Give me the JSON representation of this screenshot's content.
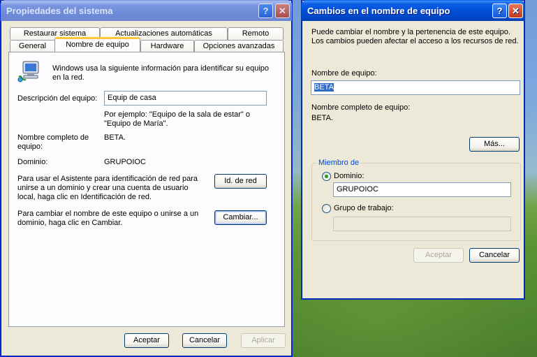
{
  "left_window": {
    "title": "Propiedades del sistema",
    "help_glyph": "?",
    "close_glyph": "✕",
    "tabs_row1": [
      "Restaurar sistema",
      "Actualizaciones automáticas",
      "Remoto"
    ],
    "tabs_row2": [
      "General",
      "Nombre de equipo",
      "Hardware",
      "Opciones avanzadas"
    ],
    "intro_text": "Windows usa la siguiente información para identificar su equipo en la red.",
    "description_label": "Descripción del equipo:",
    "description_value": "Equip de casa",
    "example_text": "Por ejemplo: \"Equipo de la sala de estar\" o \"Equipo de María\".",
    "full_name_label": "Nombre completo de equipo:",
    "full_name_value": "BETA.",
    "domain_label": "Dominio:",
    "domain_value": "GRUPOIOC",
    "network_id_text": "Para usar el Asistente para identificación de red para unirse a un dominio y crear una cuenta de usuario local, haga clic en Identificación de red.",
    "network_id_button": "Id. de red",
    "change_text": "Para cambiar el nombre de este equipo o unirse a un dominio, haga clic en Cambiar.",
    "change_button": "Cambiar...",
    "ok_button": "Aceptar",
    "cancel_button": "Cancelar",
    "apply_button": "Aplicar",
    "icon": "computer-network-icon"
  },
  "right_window": {
    "title": "Cambios en el nombre de equipo",
    "help_glyph": "?",
    "close_glyph": "✕",
    "intro_text": "Puede cambiar el nombre y la pertenencia de este equipo. Los cambios pueden afectar el acceso a los recursos de red.",
    "computer_name_label": "Nombre de equipo:",
    "computer_name_value": "BETA",
    "full_name_label": "Nombre completo de equipo:",
    "full_name_value": "BETA.",
    "more_button": "Más...",
    "member_of_label": "Miembro de",
    "domain_radio_label": "Dominio:",
    "domain_value": "GRUPOIOC",
    "workgroup_radio_label": "Grupo de trabajo:",
    "workgroup_value": "",
    "ok_button": "Aceptar",
    "cancel_button": "Cancelar"
  },
  "colors": {
    "titlebar_active": "#0054e3",
    "window_face": "#ece9d8",
    "group_legend": "#0046d5",
    "tab_highlight": "#ffc83c"
  }
}
